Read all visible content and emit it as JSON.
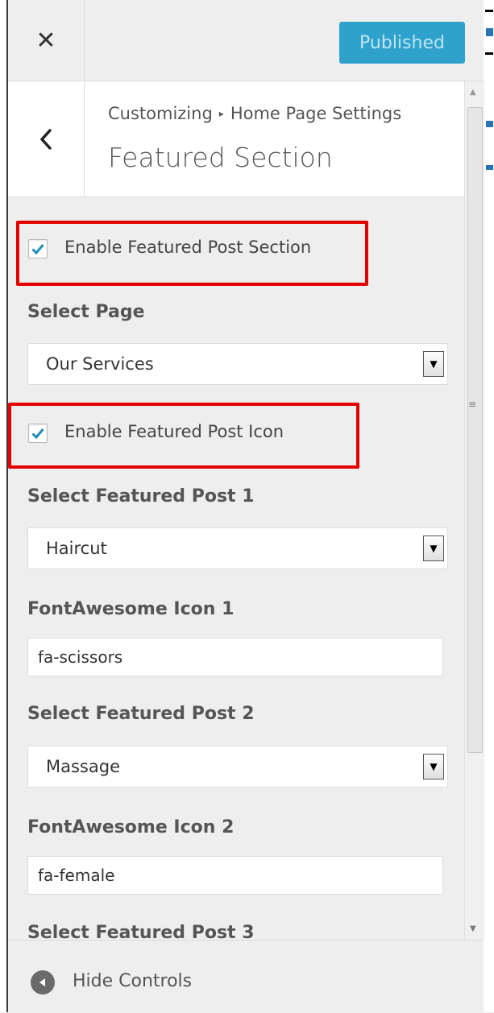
{
  "header": {
    "close_icon": "✕",
    "publish_label": "Published"
  },
  "section": {
    "back_icon": "‹",
    "breadcrumb_parent": "Customizing",
    "breadcrumb_separator": "▸",
    "breadcrumb_current": "Home Page Settings",
    "title": "Featured Section"
  },
  "controls": {
    "enable_section": {
      "label": "Enable Featured Post Section",
      "checked": true
    },
    "select_page": {
      "label": "Select Page",
      "value": "Our Services"
    },
    "enable_icon": {
      "label": "Enable Featured Post Icon",
      "checked": true
    },
    "post1": {
      "label": "Select Featured Post 1",
      "value": "Haircut"
    },
    "icon1": {
      "label": "FontAwesome Icon 1",
      "value": "fa-scissors"
    },
    "post2": {
      "label": "Select Featured Post 2",
      "value": "Massage"
    },
    "icon2": {
      "label": "FontAwesome Icon 2",
      "value": "fa-female"
    },
    "post3": {
      "label": "Select Featured Post 3"
    }
  },
  "footer": {
    "hide_label": "Hide Controls"
  },
  "colors": {
    "accent": "#2ea2cc",
    "highlight": "#e30000",
    "check": "#1e8cbe"
  }
}
